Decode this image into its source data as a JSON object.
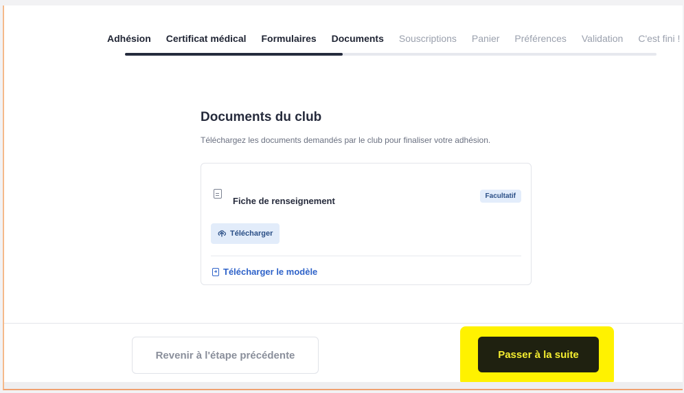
{
  "stepper": {
    "steps": [
      {
        "label": "Adhésion",
        "state": "done"
      },
      {
        "label": "Certificat médical",
        "state": "done"
      },
      {
        "label": "Formulaires",
        "state": "done"
      },
      {
        "label": "Documents",
        "state": "current"
      },
      {
        "label": "Souscriptions",
        "state": "todo"
      },
      {
        "label": "Panier",
        "state": "todo"
      },
      {
        "label": "Préférences",
        "state": "todo"
      },
      {
        "label": "Validation",
        "state": "todo"
      },
      {
        "label": "C'est fini !",
        "state": "todo"
      }
    ],
    "progress": 0.41
  },
  "documents": {
    "title": "Documents du club",
    "subtitle": "Téléchargez les documents demandés par le club pour finaliser votre adhésion.",
    "items": [
      {
        "name": "Fiche de renseignement",
        "badge": "Facultatif",
        "upload_label": "Télécharger",
        "template_label": "Télécharger le modèle"
      }
    ]
  },
  "footer": {
    "back_label": "Revenir à l'étape précédente",
    "next_label": "Passer à la suite"
  },
  "icons": {
    "document": "document-icon",
    "upload": "cloud-upload-icon",
    "template": "document-plus-icon"
  },
  "colors": {
    "accent": "#2f63c9",
    "highlight": "#fff200",
    "next_button_bg": "#1f2110",
    "next_button_text": "#f5ee30",
    "badge_bg": "#e3edfb"
  }
}
